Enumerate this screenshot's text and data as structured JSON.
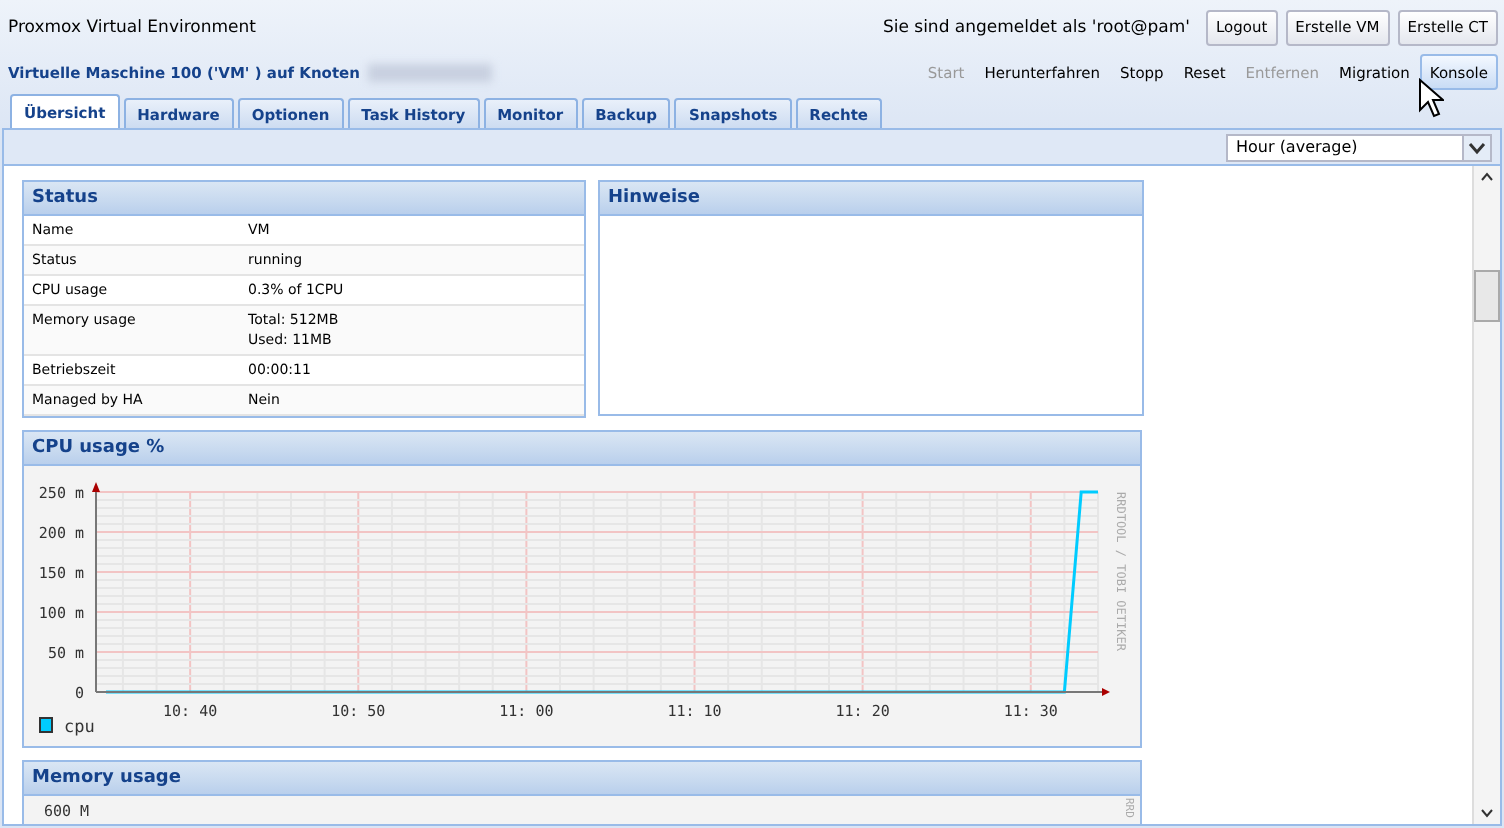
{
  "app_title": "Proxmox Virtual Environment",
  "login_text": "Sie sind angemeldet als 'root@pam'",
  "header_buttons": [
    "Logout",
    "Erstelle VM",
    "Erstelle CT"
  ],
  "vm_title": "Virtuelle Maschine 100 ('VM' ) auf Knoten",
  "actions": [
    {
      "label": "Start",
      "disabled": true,
      "hovered": false
    },
    {
      "label": "Herunterfahren",
      "disabled": false,
      "hovered": false
    },
    {
      "label": "Stopp",
      "disabled": false,
      "hovered": false
    },
    {
      "label": "Reset",
      "disabled": false,
      "hovered": false
    },
    {
      "label": "Entfernen",
      "disabled": true,
      "hovered": false
    },
    {
      "label": "Migration",
      "disabled": false,
      "hovered": false
    },
    {
      "label": "Konsole",
      "disabled": false,
      "hovered": true
    }
  ],
  "tabs": [
    {
      "label": "Übersicht",
      "selected": true
    },
    {
      "label": "Hardware",
      "selected": false
    },
    {
      "label": "Optionen",
      "selected": false
    },
    {
      "label": "Task History",
      "selected": false
    },
    {
      "label": "Monitor",
      "selected": false
    },
    {
      "label": "Backup",
      "selected": false
    },
    {
      "label": "Snapshots",
      "selected": false
    },
    {
      "label": "Rechte",
      "selected": false
    }
  ],
  "timeframe": {
    "value": "Hour (average)"
  },
  "status": {
    "title": "Status",
    "rows": [
      {
        "key": "Name",
        "value": "VM"
      },
      {
        "key": "Status",
        "value": "running"
      },
      {
        "key": "CPU usage",
        "value": "0.3% of 1CPU"
      },
      {
        "key": "Memory usage",
        "value": "Total: 512MB\nUsed: 11MB"
      },
      {
        "key": "Betriebszeit",
        "value": "00:00:11"
      },
      {
        "key": "Managed by HA",
        "value": "Nein"
      }
    ]
  },
  "notes": {
    "title": "Hinweise"
  },
  "cpu_chart": {
    "title": "CPU usage %",
    "watermark": "RRDTOOL / TOBI OETIKER",
    "chart_data": {
      "type": "line",
      "categories": [
        null,
        null,
        null,
        null,
        null,
        "10: 40",
        null,
        null,
        null,
        null,
        null,
        null,
        null,
        null,
        null,
        "10: 50",
        null,
        null,
        null,
        null,
        null,
        null,
        null,
        null,
        null,
        "11: 00",
        null,
        null,
        null,
        null,
        null,
        null,
        null,
        null,
        null,
        "11: 10",
        null,
        null,
        null,
        null,
        null,
        null,
        null,
        null,
        null,
        "11: 20",
        null,
        null,
        null,
        null,
        null,
        null,
        null,
        null,
        null,
        "11: 30",
        null,
        null,
        null,
        null
      ],
      "ylim": [
        0,
        250
      ],
      "grid": true,
      "yticks": [
        {
          "value": 0,
          "label": "0"
        },
        {
          "value": 50,
          "label": "50 m"
        },
        {
          "value": 100,
          "label": "100 m"
        },
        {
          "value": 150,
          "label": "150 m"
        },
        {
          "value": 200,
          "label": "200 m"
        },
        {
          "value": 250,
          "label": "250 m"
        }
      ],
      "series": [
        {
          "name": "cpu",
          "color": "#00ccff",
          "values": [
            0,
            0,
            0,
            0,
            0,
            0,
            0,
            0,
            0,
            0,
            0,
            0,
            0,
            0,
            0,
            0,
            0,
            0,
            0,
            0,
            0,
            0,
            0,
            0,
            0,
            0,
            0,
            0,
            0,
            0,
            0,
            0,
            0,
            0,
            0,
            0,
            0,
            0,
            0,
            0,
            0,
            0,
            0,
            0,
            0,
            0,
            0,
            0,
            0,
            0,
            0,
            0,
            0,
            0,
            0,
            0,
            0,
            0,
            250,
            250
          ]
        }
      ]
    }
  },
  "memory_chart": {
    "title": "Memory usage",
    "first_tick": "600 M",
    "watermark": "RRD"
  }
}
